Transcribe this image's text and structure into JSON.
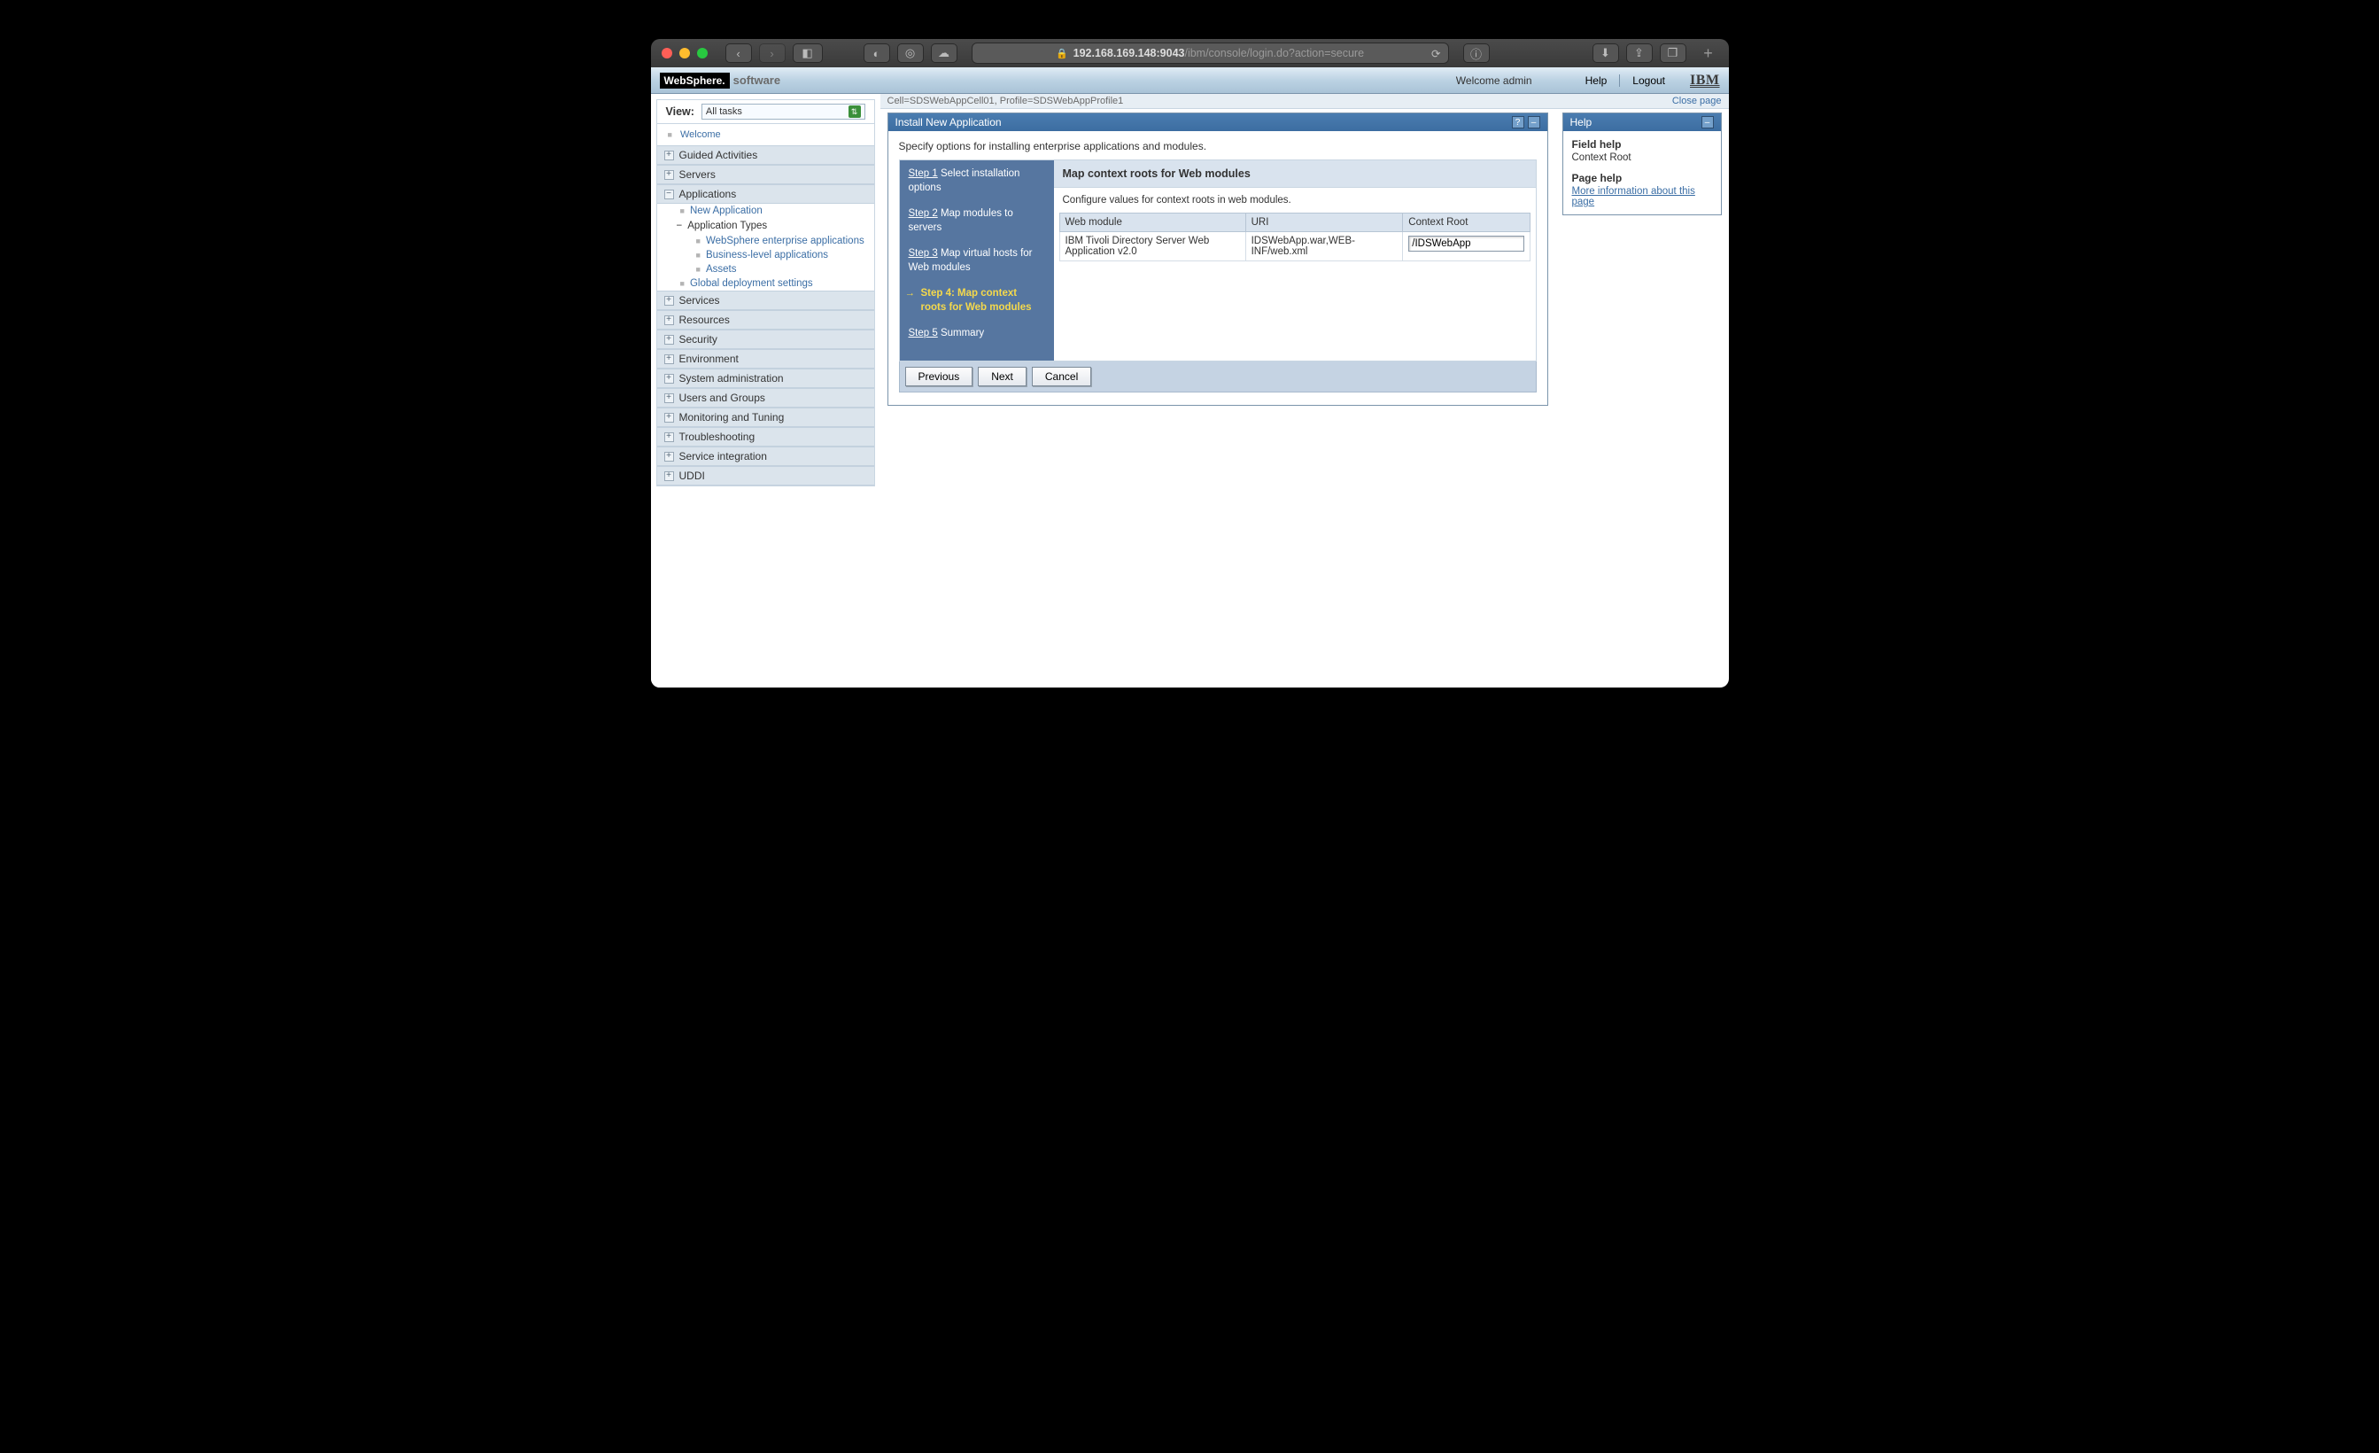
{
  "browser": {
    "url_secure_host": "192.168.169.148:9043",
    "url_tail": "/ibm/console/login.do?action=secure"
  },
  "header": {
    "brand_black": "WebSphere.",
    "brand_grey": "software",
    "welcome": "Welcome admin",
    "help": "Help",
    "logout": "Logout",
    "ibm": "IBM"
  },
  "nav": {
    "view_label": "View:",
    "view_value": "All tasks",
    "welcome": "Welcome",
    "cats": {
      "guided": "Guided Activities",
      "servers": "Servers",
      "applications": "Applications",
      "services": "Services",
      "resources": "Resources",
      "security": "Security",
      "environment": "Environment",
      "sysadmin": "System administration",
      "users": "Users and Groups",
      "monitoring": "Monitoring and Tuning",
      "troubleshoot": "Troubleshooting",
      "service_int": "Service integration",
      "uddi": "UDDI"
    },
    "apps": {
      "new_app": "New Application",
      "app_types": "Application Types",
      "ws_ent": "WebSphere enterprise applications",
      "bla": "Business-level applications",
      "assets": "Assets",
      "global": "Global deployment settings"
    }
  },
  "crumb": {
    "cell": "Cell=SDSWebAppCell01, Profile=SDSWebAppProfile1",
    "close": "Close page"
  },
  "install": {
    "title": "Install New Application",
    "desc": "Specify options for installing enterprise applications and modules.",
    "steps": {
      "s1_link": "Step 1",
      "s1_text": "Select installation options",
      "s2_link": "Step 2",
      "s2_text": "Map modules to servers",
      "s3_link": "Step 3",
      "s3_text": "Map virtual hosts for Web modules",
      "s4": "Step 4: Map context roots for Web modules",
      "s5_link": "Step 5",
      "s5_text": "Summary"
    },
    "body_title": "Map context roots for Web modules",
    "body_sub": "Configure values for context roots in web modules.",
    "table": {
      "h1": "Web module",
      "h2": "URI",
      "h3": "Context Root",
      "r1c1": "IBM Tivoli Directory Server Web Application v2.0",
      "r1c2": "IDSWebApp.war,WEB-INF/web.xml",
      "r1c3": "/IDSWebApp"
    },
    "buttons": {
      "prev": "Previous",
      "next": "Next",
      "cancel": "Cancel"
    }
  },
  "help": {
    "title": "Help",
    "field_label": "Field help",
    "field_value": "Context Root",
    "page_label": "Page help",
    "page_link": "More information about this page"
  }
}
